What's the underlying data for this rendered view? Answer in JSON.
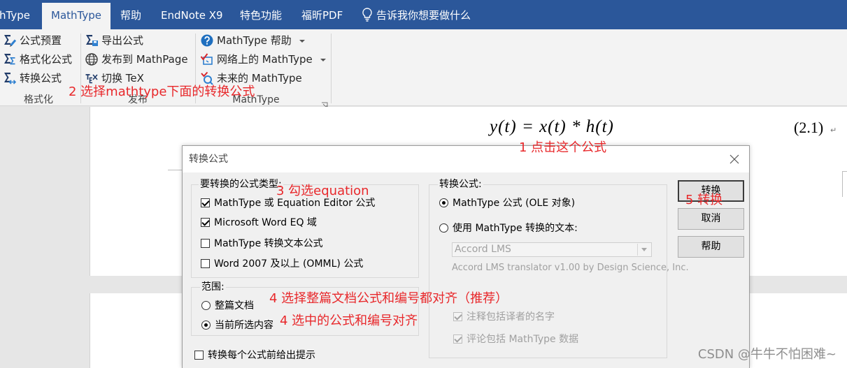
{
  "tabs": [
    {
      "label": "hType",
      "active": false
    },
    {
      "label": "MathType",
      "active": true
    },
    {
      "label": "帮助",
      "active": false
    },
    {
      "label": "EndNote X9",
      "active": false
    },
    {
      "label": "特色功能",
      "active": false
    },
    {
      "label": "福昕PDF",
      "active": false
    }
  ],
  "tell_me": {
    "icon": "lightbulb-icon",
    "label": "告诉我你想要做什么"
  },
  "ribbon": {
    "groups": [
      {
        "label": "格式化",
        "items": [
          {
            "label": "公式预置",
            "icon": "equation-preferences-icon",
            "dropdown": false
          },
          {
            "label": "格式化公式",
            "icon": "format-equations-icon",
            "dropdown": false
          },
          {
            "label": "转换公式",
            "icon": "convert-equations-icon",
            "dropdown": false
          }
        ]
      },
      {
        "label": "发布",
        "items": [
          {
            "label": "导出公式",
            "icon": "export-equations-icon",
            "dropdown": false
          },
          {
            "label": "发布到 MathPage",
            "icon": "globe-icon",
            "dropdown": false
          },
          {
            "label": "切换 TeX",
            "icon": "tex-icon",
            "dropdown": false
          }
        ]
      },
      {
        "label": "MathType",
        "items": [
          {
            "label": "MathType 帮助",
            "icon": "help-icon",
            "dropdown": true
          },
          {
            "label": "网络上的 MathType",
            "icon": "web-icon",
            "dropdown": true
          },
          {
            "label": "未来的 MathType",
            "icon": "future-icon",
            "dropdown": false
          }
        ]
      }
    ]
  },
  "document": {
    "equation": "y(t) = x(t) * h(t)",
    "equation_number": "(2.1)",
    "paragraph_mark": "↵"
  },
  "dialog": {
    "title": "转换公式",
    "types_group": {
      "legend": "要转换的公式类型:",
      "options": [
        {
          "label": "MathType 或 Equation Editor 公式",
          "checked": true
        },
        {
          "label": "Microsoft Word EQ 域",
          "checked": true
        },
        {
          "label": "MathType 转换文本公式",
          "checked": false
        },
        {
          "label": "Word 2007 及以上 (OMML) 公式",
          "checked": false
        }
      ]
    },
    "range_group": {
      "legend": "范围:",
      "options": [
        {
          "label": "整篇文档",
          "selected": false
        },
        {
          "label": "当前所选内容",
          "selected": true
        }
      ]
    },
    "prompt_checkbox": {
      "label": "转换每个公式前给出提示",
      "checked": false
    },
    "convert_to_group": {
      "legend": "转换公式:",
      "options": [
        {
          "label": "MathType 公式 (OLE 对象)",
          "selected": true
        },
        {
          "label": "使用 MathType 转换的文本:",
          "selected": false
        }
      ],
      "translator_select": {
        "value": "Accord LMS",
        "disabled": true
      },
      "translator_info": "Accord LMS translator v1.00 by Design Science, Inc.",
      "extra_options": [
        {
          "label": "注释包括译者的名字",
          "checked": true,
          "disabled": true
        },
        {
          "label": "评论包括 MathType 数据",
          "checked": true,
          "disabled": true
        }
      ]
    },
    "buttons": {
      "convert": "转换",
      "cancel": "取消",
      "help": "帮助"
    }
  },
  "annotations": {
    "step1": "1 点击这个公式",
    "step2": "2 选择mathtype下面的转换公式",
    "step3": "3 勾选equation",
    "step4a": "4 选择整篇文档公式和编号都对齐（推荐）",
    "step4b": "4 选中的公式和编号对齐",
    "step5": "5 转换"
  },
  "watermark": "CSDN @牛牛不怕困难~",
  "colors": {
    "title_bar": "#2B579A",
    "ribbon": "#F3F3F3",
    "dialog": "#F0F0F0",
    "annotation": "#E8282B"
  }
}
